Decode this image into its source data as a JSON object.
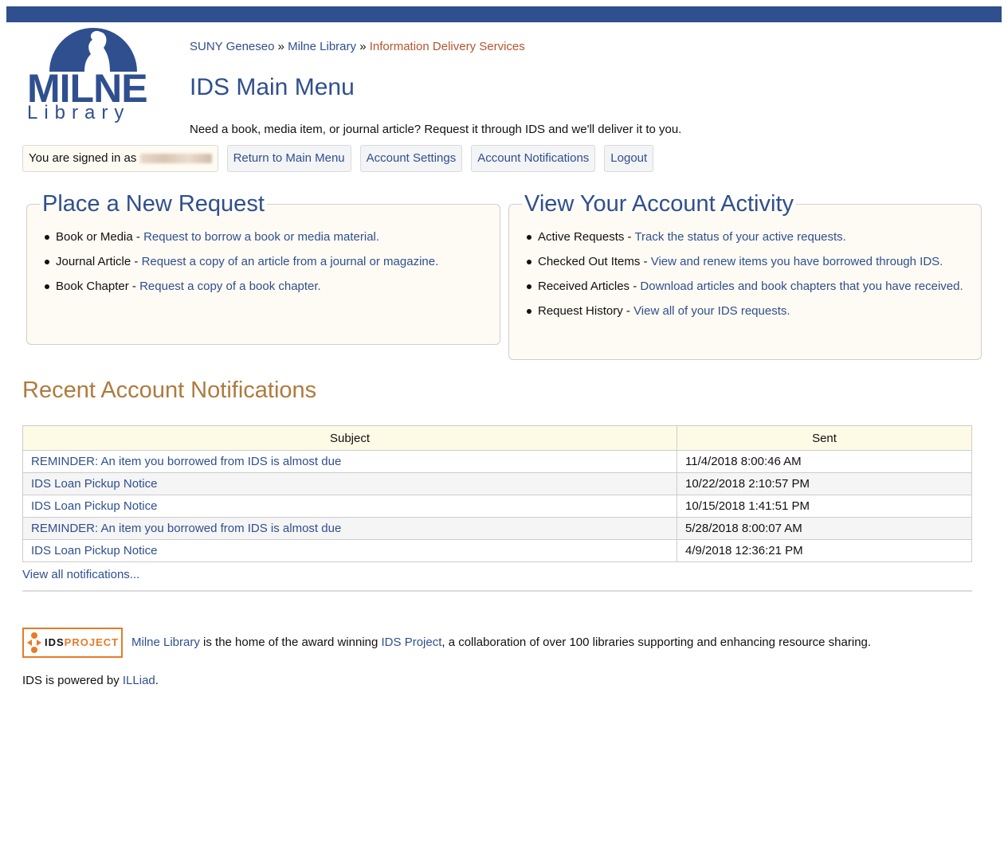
{
  "logo": {
    "word": "MILNE",
    "sub": "Library"
  },
  "breadcrumb": {
    "home": "SUNY Geneseo",
    "sep": "»",
    "library": "Milne Library",
    "current": "Information Delivery Services"
  },
  "page_title": "IDS Main Menu",
  "intro": "Need a book, media item, or journal article? Request it through IDS and we'll deliver it to you.",
  "nav": {
    "signed_in_label": "You are signed in as",
    "return_main": "Return to Main Menu",
    "account_settings": "Account Settings",
    "account_notifications": "Account Notifications",
    "logout": "Logout"
  },
  "new_request": {
    "title": "Place a New Request",
    "items": [
      {
        "label": "Book or Media",
        "link": "Request to borrow a book or media material."
      },
      {
        "label": "Journal Article",
        "link": "Request a copy of an article from a journal or magazine."
      },
      {
        "label": "Book Chapter",
        "link": "Request a copy of a book chapter."
      }
    ]
  },
  "activity": {
    "title": "View Your Account Activity",
    "items": [
      {
        "label": "Active Requests",
        "link": "Track the status of your active requests."
      },
      {
        "label": "Checked Out Items",
        "link": "View and renew items you have borrowed through IDS."
      },
      {
        "label": "Received Articles",
        "link": "Download articles and book chapters that you have received."
      },
      {
        "label": "Request History",
        "link": "View all of your IDS requests."
      }
    ]
  },
  "notifications": {
    "title": "Recent Account Notifications",
    "columns": [
      "Subject",
      "Sent"
    ],
    "rows": [
      {
        "subject": "REMINDER: An item you borrowed from IDS is almost due",
        "sent": "11/4/2018 8:00:46 AM"
      },
      {
        "subject": "IDS Loan Pickup Notice",
        "sent": "10/22/2018 2:10:57 PM"
      },
      {
        "subject": "IDS Loan Pickup Notice",
        "sent": "10/15/2018 1:41:51 PM"
      },
      {
        "subject": "REMINDER: An item you borrowed from IDS is almost due",
        "sent": "5/28/2018 8:00:07 AM"
      },
      {
        "subject": "IDS Loan Pickup Notice",
        "sent": "4/9/2018 12:36:21 PM"
      }
    ],
    "view_all": "View all notifications..."
  },
  "footer": {
    "badge_ids": "IDS",
    "badge_project": "PROJECT",
    "milne_link": "Milne Library",
    "text1": " is the home of the award winning ",
    "ids_project_link": "IDS Project",
    "text2": ", a collaboration of over 100 libraries supporting and enhancing resource sharing.",
    "powered_text": "IDS is powered by ",
    "illiad_link": "ILLiad",
    "period": "."
  },
  "colors": {
    "brand_blue": "#2f4f8f",
    "accent_orange": "#e87a28",
    "heading_tan": "#b07a3e",
    "current_crumb": "#b5552e"
  }
}
